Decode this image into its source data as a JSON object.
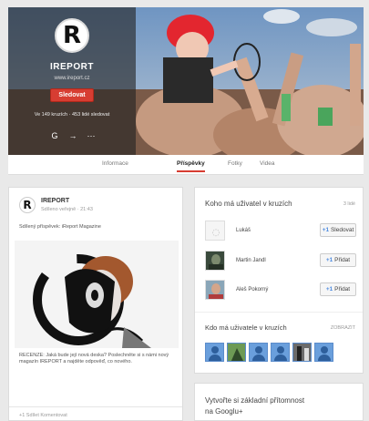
{
  "profile": {
    "name": "IREPORT",
    "url": "www.ireport.cz",
    "follow_label": "Sledovat",
    "circles_text": "Ve 149 kruzích · 453 lidé sledovat"
  },
  "tabs": [
    {
      "label": "Informace"
    },
    {
      "label": "Příspěvky"
    },
    {
      "label": "Fotky"
    },
    {
      "label": "Videa"
    }
  ],
  "post": {
    "author": "IREPORT",
    "meta": "Sdíleno veřejně · 21:43",
    "shared_line": "Sdílený příspěvek: iReport Magazine",
    "body": "RECENZE: Jaká bude její nová deska? Poslechněte si s námi nový magazín IREPORT a najděte odpověď, co nového.",
    "footer": "+1   Sdílet   Komentovat"
  },
  "circles_card": {
    "heading": "Koho má uživatel v kruzích",
    "count": "3 lidé",
    "people": [
      {
        "name": "Lukáš",
        "button": "Sledovat"
      },
      {
        "name": "Martin Jandl",
        "button": "Přidat"
      },
      {
        "name": "Aleš Pokorný",
        "button": "Přidat"
      }
    ],
    "sub_heading": "Kdo má uživatele v kruzích",
    "sub_count": "ZOBRAZIT"
  },
  "promo": {
    "text": "Vytvořte si základní přítomnost na Googlu+"
  },
  "colors": {
    "accent_red": "#d73d32",
    "link_blue": "#4d8be0"
  }
}
